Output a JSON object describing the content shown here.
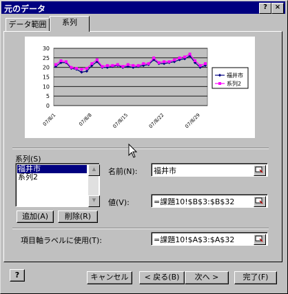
{
  "window": {
    "title": "元のデータ",
    "help_button": "?",
    "close_button": "×"
  },
  "tabs": [
    {
      "label": "データ範囲"
    },
    {
      "label": "系列"
    }
  ],
  "chart_data": {
    "type": "line",
    "x": [
      "07/8/1",
      "07/8/2",
      "07/8/3",
      "07/8/4",
      "07/8/5",
      "07/8/6",
      "07/8/7",
      "07/8/8",
      "07/8/9",
      "07/8/10",
      "07/8/11",
      "07/8/12",
      "07/8/13",
      "07/8/14",
      "07/8/15",
      "07/8/16",
      "07/8/17",
      "07/8/18",
      "07/8/19",
      "07/8/20",
      "07/8/21",
      "07/8/22",
      "07/8/23",
      "07/8/24",
      "07/8/25",
      "07/8/26",
      "07/8/27",
      "07/8/28",
      "07/8/29",
      "07/8/30"
    ],
    "xtick_labels": [
      "07/8/1",
      "07/8/8",
      "07/8/15",
      "07/8/22",
      "07/8/29"
    ],
    "ylim": [
      0,
      30
    ],
    "yticks": [
      "0",
      "5",
      "10",
      "15",
      "20",
      "25",
      "30"
    ],
    "grid": true,
    "legend_position": "right",
    "series": [
      {
        "name": "福井市",
        "color": "#000080",
        "marker": "diamond",
        "values": [
          20.5,
          22.5,
          22.5,
          19.5,
          19,
          17.5,
          18,
          21,
          23,
          20,
          20,
          20.5,
          21,
          20,
          20.5,
          20,
          20.5,
          21,
          21.5,
          24,
          22,
          22,
          22.5,
          23,
          24,
          24.5,
          26,
          22.5,
          20,
          21
        ]
      },
      {
        "name": "系列2",
        "color": "#ff00ff",
        "marker": "square",
        "values": [
          21.5,
          23.5,
          23,
          20,
          19.5,
          19,
          19.5,
          22,
          24,
          20.5,
          21,
          21,
          21.5,
          20.5,
          21.5,
          21,
          21,
          22,
          22,
          25,
          22.5,
          23,
          23,
          24,
          25,
          25.5,
          27,
          23.5,
          21,
          22
        ]
      }
    ]
  },
  "series_section": {
    "label": "系列(S)",
    "items": [
      "福井市",
      "系列2"
    ],
    "selected_index": 0,
    "add_button": "追加(A)",
    "delete_button": "削除(R)"
  },
  "fields": {
    "name_label": "名前(N):",
    "name_value": "福井市",
    "value_label": "値(V):",
    "value_value": "=課題10!$B$3:$B$32",
    "category_label": "項目軸ラベルに使用(T):",
    "category_value": "=課題10!$A$3:$A$32"
  },
  "footer": {
    "help_icon": "?",
    "cancel": "キャンセル",
    "back": "< 戻る(B)",
    "next": "次へ >",
    "finish": "完了(F)"
  }
}
